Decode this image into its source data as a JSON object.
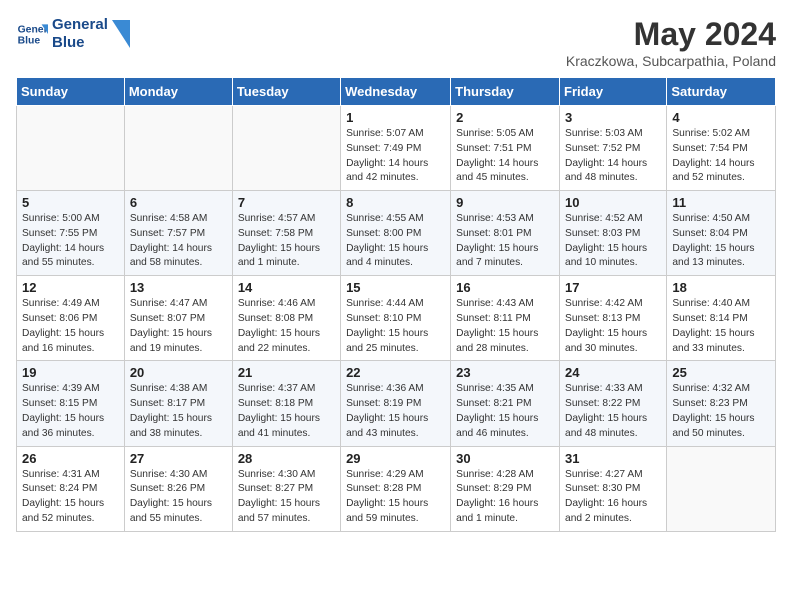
{
  "header": {
    "logo_line1": "General",
    "logo_line2": "Blue",
    "month_title": "May 2024",
    "location": "Kraczkowa, Subcarpathia, Poland"
  },
  "days_of_week": [
    "Sunday",
    "Monday",
    "Tuesday",
    "Wednesday",
    "Thursday",
    "Friday",
    "Saturday"
  ],
  "weeks": [
    [
      {
        "day": "",
        "info": ""
      },
      {
        "day": "",
        "info": ""
      },
      {
        "day": "",
        "info": ""
      },
      {
        "day": "1",
        "info": "Sunrise: 5:07 AM\nSunset: 7:49 PM\nDaylight: 14 hours\nand 42 minutes."
      },
      {
        "day": "2",
        "info": "Sunrise: 5:05 AM\nSunset: 7:51 PM\nDaylight: 14 hours\nand 45 minutes."
      },
      {
        "day": "3",
        "info": "Sunrise: 5:03 AM\nSunset: 7:52 PM\nDaylight: 14 hours\nand 48 minutes."
      },
      {
        "day": "4",
        "info": "Sunrise: 5:02 AM\nSunset: 7:54 PM\nDaylight: 14 hours\nand 52 minutes."
      }
    ],
    [
      {
        "day": "5",
        "info": "Sunrise: 5:00 AM\nSunset: 7:55 PM\nDaylight: 14 hours\nand 55 minutes."
      },
      {
        "day": "6",
        "info": "Sunrise: 4:58 AM\nSunset: 7:57 PM\nDaylight: 14 hours\nand 58 minutes."
      },
      {
        "day": "7",
        "info": "Sunrise: 4:57 AM\nSunset: 7:58 PM\nDaylight: 15 hours\nand 1 minute."
      },
      {
        "day": "8",
        "info": "Sunrise: 4:55 AM\nSunset: 8:00 PM\nDaylight: 15 hours\nand 4 minutes."
      },
      {
        "day": "9",
        "info": "Sunrise: 4:53 AM\nSunset: 8:01 PM\nDaylight: 15 hours\nand 7 minutes."
      },
      {
        "day": "10",
        "info": "Sunrise: 4:52 AM\nSunset: 8:03 PM\nDaylight: 15 hours\nand 10 minutes."
      },
      {
        "day": "11",
        "info": "Sunrise: 4:50 AM\nSunset: 8:04 PM\nDaylight: 15 hours\nand 13 minutes."
      }
    ],
    [
      {
        "day": "12",
        "info": "Sunrise: 4:49 AM\nSunset: 8:06 PM\nDaylight: 15 hours\nand 16 minutes."
      },
      {
        "day": "13",
        "info": "Sunrise: 4:47 AM\nSunset: 8:07 PM\nDaylight: 15 hours\nand 19 minutes."
      },
      {
        "day": "14",
        "info": "Sunrise: 4:46 AM\nSunset: 8:08 PM\nDaylight: 15 hours\nand 22 minutes."
      },
      {
        "day": "15",
        "info": "Sunrise: 4:44 AM\nSunset: 8:10 PM\nDaylight: 15 hours\nand 25 minutes."
      },
      {
        "day": "16",
        "info": "Sunrise: 4:43 AM\nSunset: 8:11 PM\nDaylight: 15 hours\nand 28 minutes."
      },
      {
        "day": "17",
        "info": "Sunrise: 4:42 AM\nSunset: 8:13 PM\nDaylight: 15 hours\nand 30 minutes."
      },
      {
        "day": "18",
        "info": "Sunrise: 4:40 AM\nSunset: 8:14 PM\nDaylight: 15 hours\nand 33 minutes."
      }
    ],
    [
      {
        "day": "19",
        "info": "Sunrise: 4:39 AM\nSunset: 8:15 PM\nDaylight: 15 hours\nand 36 minutes."
      },
      {
        "day": "20",
        "info": "Sunrise: 4:38 AM\nSunset: 8:17 PM\nDaylight: 15 hours\nand 38 minutes."
      },
      {
        "day": "21",
        "info": "Sunrise: 4:37 AM\nSunset: 8:18 PM\nDaylight: 15 hours\nand 41 minutes."
      },
      {
        "day": "22",
        "info": "Sunrise: 4:36 AM\nSunset: 8:19 PM\nDaylight: 15 hours\nand 43 minutes."
      },
      {
        "day": "23",
        "info": "Sunrise: 4:35 AM\nSunset: 8:21 PM\nDaylight: 15 hours\nand 46 minutes."
      },
      {
        "day": "24",
        "info": "Sunrise: 4:33 AM\nSunset: 8:22 PM\nDaylight: 15 hours\nand 48 minutes."
      },
      {
        "day": "25",
        "info": "Sunrise: 4:32 AM\nSunset: 8:23 PM\nDaylight: 15 hours\nand 50 minutes."
      }
    ],
    [
      {
        "day": "26",
        "info": "Sunrise: 4:31 AM\nSunset: 8:24 PM\nDaylight: 15 hours\nand 52 minutes."
      },
      {
        "day": "27",
        "info": "Sunrise: 4:30 AM\nSunset: 8:26 PM\nDaylight: 15 hours\nand 55 minutes."
      },
      {
        "day": "28",
        "info": "Sunrise: 4:30 AM\nSunset: 8:27 PM\nDaylight: 15 hours\nand 57 minutes."
      },
      {
        "day": "29",
        "info": "Sunrise: 4:29 AM\nSunset: 8:28 PM\nDaylight: 15 hours\nand 59 minutes."
      },
      {
        "day": "30",
        "info": "Sunrise: 4:28 AM\nSunset: 8:29 PM\nDaylight: 16 hours\nand 1 minute."
      },
      {
        "day": "31",
        "info": "Sunrise: 4:27 AM\nSunset: 8:30 PM\nDaylight: 16 hours\nand 2 minutes."
      },
      {
        "day": "",
        "info": ""
      }
    ]
  ]
}
